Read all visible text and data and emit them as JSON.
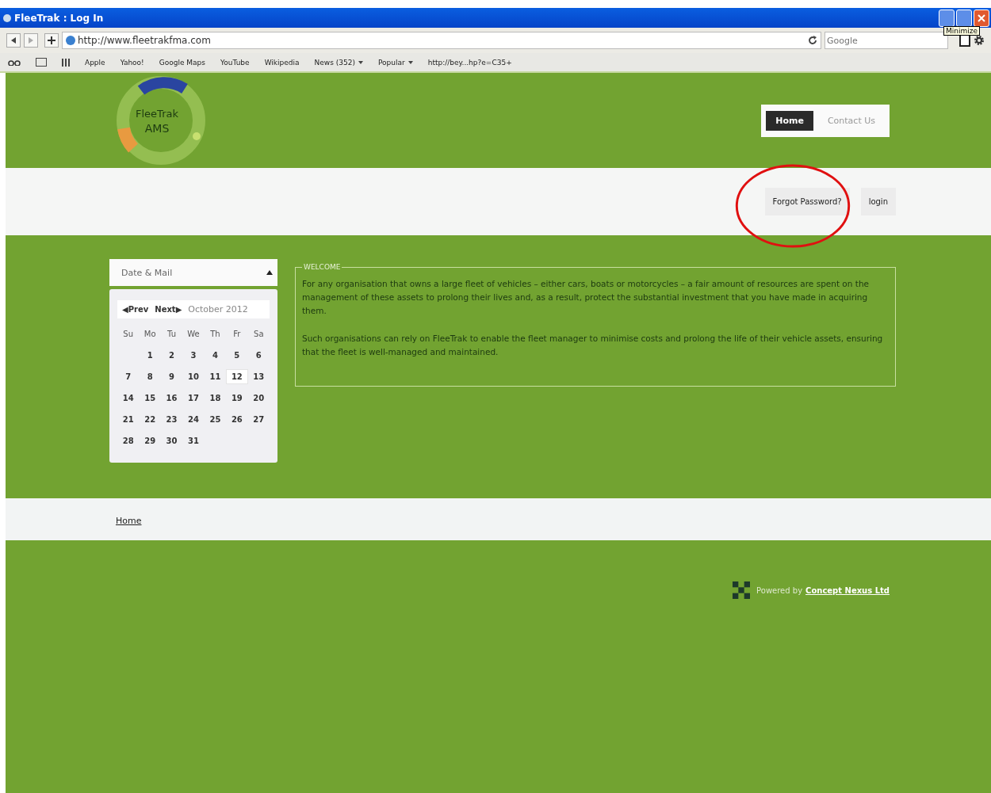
{
  "window": {
    "title": "FleeTrak : Log In",
    "tooltip": "Minimize"
  },
  "browser": {
    "url": "http://www.fleetrakfma.com",
    "search_placeholder": "Google",
    "bookmarks": [
      {
        "label": "Apple",
        "menu": false
      },
      {
        "label": "Yahoo!",
        "menu": false
      },
      {
        "label": "Google Maps",
        "menu": false
      },
      {
        "label": "YouTube",
        "menu": false
      },
      {
        "label": "Wikipedia",
        "menu": false
      },
      {
        "label": "News (352)",
        "menu": true
      },
      {
        "label": "Popular",
        "menu": true
      },
      {
        "label": "http://bey...hp?e=C35+",
        "menu": false
      }
    ]
  },
  "logo": {
    "line1": "FleeTrak",
    "line2": "AMS"
  },
  "nav": [
    {
      "label": "Home",
      "selected": true
    },
    {
      "label": "Contact Us",
      "selected": false
    }
  ],
  "actions": [
    "Forgot Password?",
    "login"
  ],
  "calendar": {
    "title": "Date & Mail",
    "prev": "◀Prev",
    "next": "Next▶",
    "month": "October 2012",
    "weekdays": [
      "Su",
      "Mo",
      "Tu",
      "We",
      "Th",
      "Fr",
      "Sa"
    ],
    "weeks": [
      [
        {
          "day": "1",
          "selected": false
        },
        {
          "day": "2",
          "selected": false
        },
        {
          "day": "3",
          "selected": false
        },
        {
          "day": "4",
          "selected": false
        },
        {
          "day": "5",
          "selected": false
        },
        {
          "day": "6",
          "selected": false
        }
      ],
      [
        {
          "day": "7",
          "selected": false
        },
        {
          "day": "8",
          "selected": false
        },
        {
          "day": "9",
          "selected": false
        },
        {
          "day": "10",
          "selected": false
        },
        {
          "day": "11",
          "selected": false
        },
        {
          "day": "12",
          "selected": true
        },
        {
          "day": "13",
          "selected": false
        }
      ],
      [
        {
          "day": "14",
          "selected": false
        },
        {
          "day": "15",
          "selected": false
        },
        {
          "day": "16",
          "selected": false
        },
        {
          "day": "17",
          "selected": false
        },
        {
          "day": "18",
          "selected": false
        },
        {
          "day": "19",
          "selected": false
        },
        {
          "day": "20",
          "selected": false
        }
      ],
      [
        {
          "day": "21",
          "selected": false
        },
        {
          "day": "22",
          "selected": false
        },
        {
          "day": "23",
          "selected": false
        },
        {
          "day": "24",
          "selected": false
        },
        {
          "day": "25",
          "selected": false
        },
        {
          "day": "26",
          "selected": false
        },
        {
          "day": "27",
          "selected": false
        }
      ],
      [
        {
          "day": "28",
          "selected": false
        },
        {
          "day": "29",
          "selected": false
        },
        {
          "day": "30",
          "selected": false
        },
        {
          "day": "31",
          "selected": false
        }
      ]
    ]
  },
  "welcome": {
    "legend": "WELCOME",
    "paragraphs": [
      "For any organisation that owns a large fleet of vehicles – either cars, boats or motorcycles – a fair amount of resources are spent on the management of these assets to prolong their lives and, as a result, protect the substantial investment that you have made in acquiring them.",
      "Such organisations can rely on FleeTrak to enable the fleet manager to minimise costs and prolong the life of their vehicle assets, ensuring that the fleet is well-managed and maintained."
    ]
  },
  "breadcrumb": "Home",
  "footer": {
    "prefix": "Powered by",
    "link": "Concept Nexus Ltd"
  }
}
